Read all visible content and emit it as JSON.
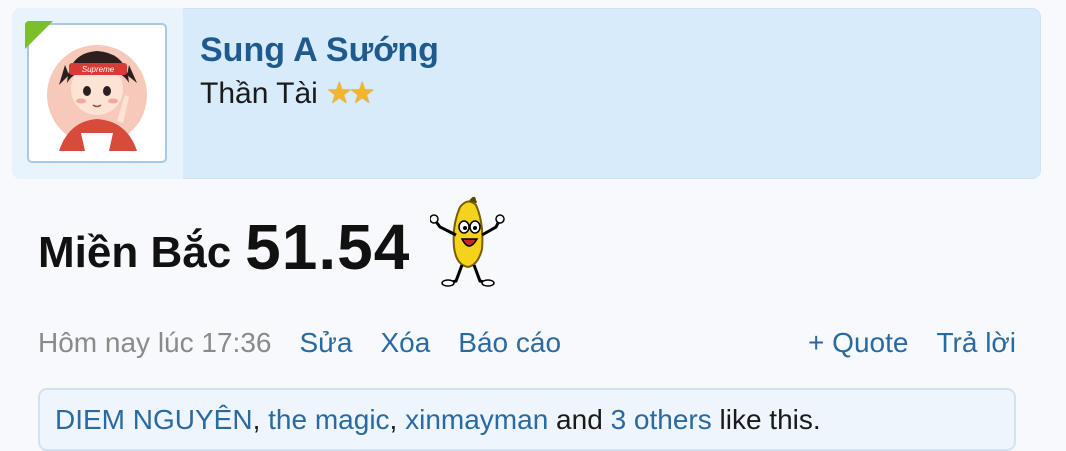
{
  "user": {
    "name": "Sung A Sướng",
    "title": "Thần Tài",
    "stars": [
      "★",
      "★"
    ],
    "avatar_text": "Supreme"
  },
  "post": {
    "label": "Miền Bắc",
    "number": "51.54",
    "emoji": "dancing-banana"
  },
  "footer": {
    "timestamp": "Hôm nay lúc 17:36",
    "edit": "Sửa",
    "delete": "Xóa",
    "report": "Báo cáo",
    "quote": "+ Quote",
    "reply": "Trả lời"
  },
  "likes": {
    "users": [
      "DIEM NGUYÊN",
      "the magic",
      "xinmayman"
    ],
    "sep": ", ",
    "and": " and ",
    "others": "3 others",
    "suffix": " like this."
  },
  "colors": {
    "link": "#2a6aa1",
    "username": "#1f5a8f",
    "card_bg": "#d8ebfb",
    "online": "#7bbf2a"
  }
}
